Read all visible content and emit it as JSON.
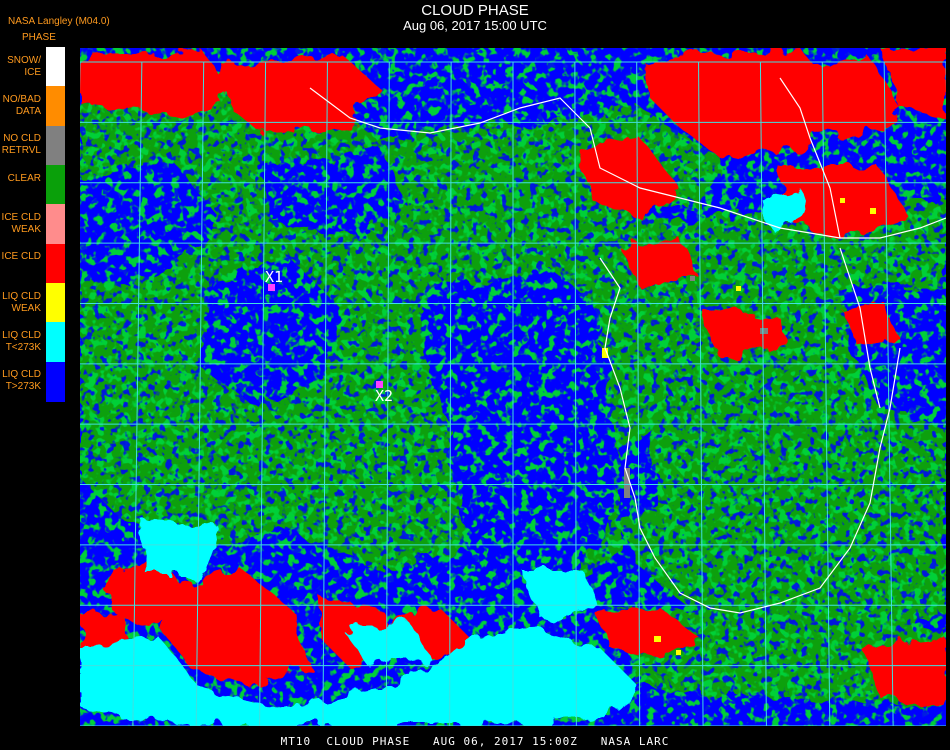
{
  "header": {
    "title": "CLOUD PHASE",
    "datetime": "Aug 06, 2017 15:00 UTC",
    "agency": "NASA Langley (M04.0)",
    "legend_title": "PHASE"
  },
  "legend": [
    {
      "label": "SNOW/\nICE",
      "color": "#ffffff"
    },
    {
      "label": "NO/BAD\nDATA",
      "color": "#ff8c00"
    },
    {
      "label": "NO CLD\nRETRVL",
      "color": "#808080"
    },
    {
      "label": "CLEAR",
      "color": "#0aa00a"
    },
    {
      "label": "ICE CLD\nWEAK",
      "color": "#ff8c8c"
    },
    {
      "label": "ICE CLD",
      "color": "#ff0000"
    },
    {
      "label": "LIQ CLD\nWEAK",
      "color": "#ffff00"
    },
    {
      "label": "LIQ CLD\nT<273K",
      "color": "#00ffff"
    },
    {
      "label": "LIQ CLD\nT>273K",
      "color": "#0000ff"
    }
  ],
  "markers": [
    {
      "label": "X1"
    },
    {
      "label": "X2"
    }
  ],
  "footer": "MT10  CLOUD PHASE   AUG 06, 2017 15:00Z   NASA LARC",
  "colors": {
    "grid": "#40e0e0",
    "coast": "#ffffff",
    "marker": "#ff40ff",
    "header_text": "#ffffff",
    "legend_text": "#ff9a1e"
  }
}
